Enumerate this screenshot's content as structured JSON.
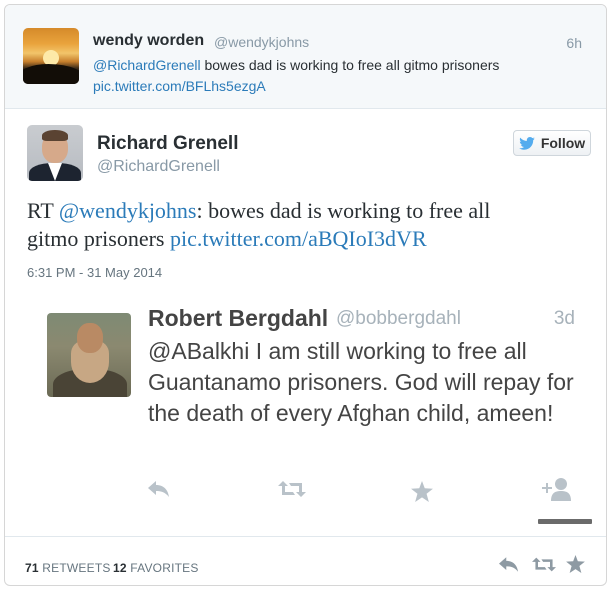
{
  "context_tweet": {
    "name": "wendy worden",
    "handle": "@wendykjohns",
    "time": "6h",
    "mention": "@RichardGrenell",
    "text": "bowes dad is working to free all gitmo prisoners",
    "link": "pic.twitter.com/BFLhs5ezgA"
  },
  "tweet": {
    "name": "Richard Grenell",
    "handle": "@RichardGrenell",
    "follow_label": "Follow",
    "rt_prefix": "RT",
    "rt_mention": "@wendykjohns",
    "text_part1": ": bowes dad is working to free all",
    "text_part2": "gitmo prisoners",
    "link": "pic.twitter.com/aBQIoI3dVR",
    "timestamp": "6:31 PM - 31 May 2014"
  },
  "embedded_tweet": {
    "name": "Robert Bergdahl",
    "handle": "@bobbergdahl",
    "time": "3d",
    "text": "@ABalkhi I am still working to free all Guantanamo prisoners. God will repay for the death of every Afghan child, ameen!"
  },
  "stats": {
    "retweets_count": "71",
    "retweets_label": "RETWEETS",
    "favorites_count": "12",
    "favorites_label": "FAVORITES"
  },
  "colors": {
    "link": "#2b7bb9",
    "muted": "#8899a6",
    "icon": "#9aa6ae"
  },
  "icons": [
    "twitter-bird-icon",
    "reply-icon",
    "retweet-icon",
    "favorite-star-icon",
    "follow-user-icon"
  ]
}
